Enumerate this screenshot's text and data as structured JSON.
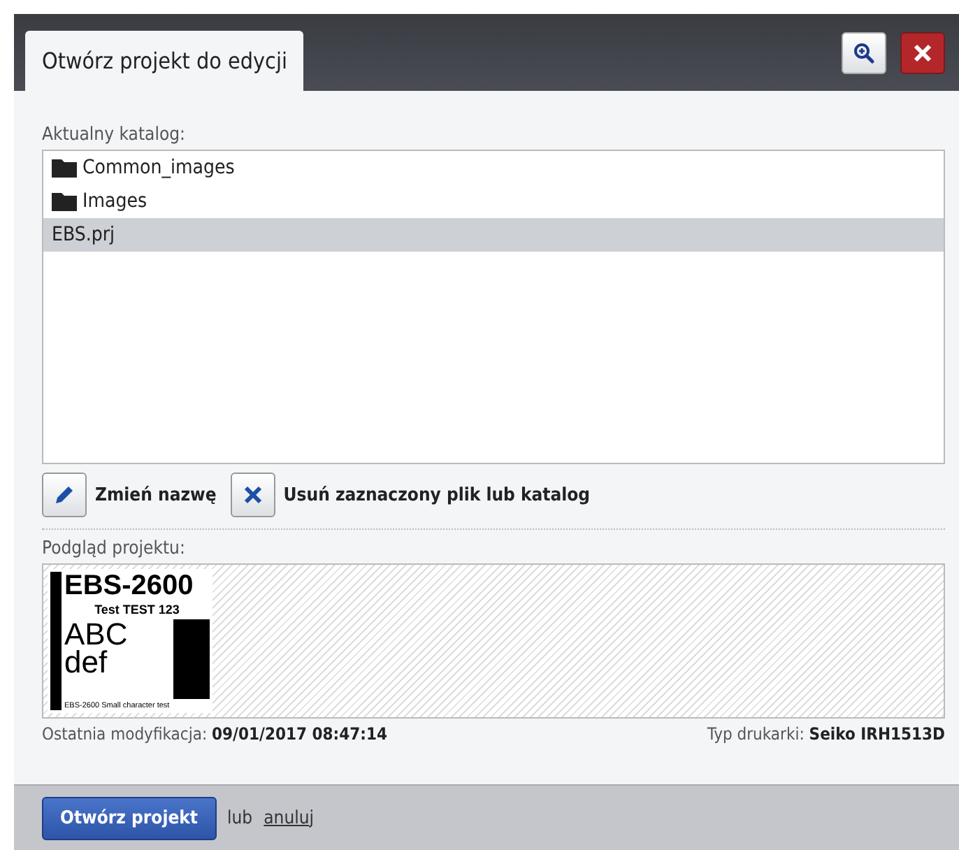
{
  "dialog": {
    "title": "Otwórz projekt do edycji"
  },
  "directory": {
    "label": "Aktualny katalog:",
    "items": [
      {
        "name": "Common_images",
        "kind": "folder",
        "selected": false
      },
      {
        "name": "Images",
        "kind": "folder",
        "selected": false
      },
      {
        "name": "EBS.prj",
        "kind": "file",
        "selected": true
      }
    ]
  },
  "actions": [
    {
      "kind": "rename",
      "label": "Zmień nazwę"
    },
    {
      "kind": "delete",
      "label": "Usuń zaznaczony plik lub katalog"
    }
  ],
  "preview": {
    "label": "Podgląd projektu:",
    "heading": "EBS-2600",
    "subheading": "Test TEST 123",
    "big_text": "ABC",
    "small_text": "def",
    "footer_text": "EBS-2600 Small character test"
  },
  "info": {
    "modified_label": "Ostatnia modyfikacja:",
    "modified_value": "09/01/2017 08:47:14",
    "printer_label": "Typ drukarki:",
    "printer_value": "Seiko IRH1513D"
  },
  "footer": {
    "open_button": "Otwórz projekt",
    "or_text": "lub",
    "cancel_link": "anuluj"
  }
}
